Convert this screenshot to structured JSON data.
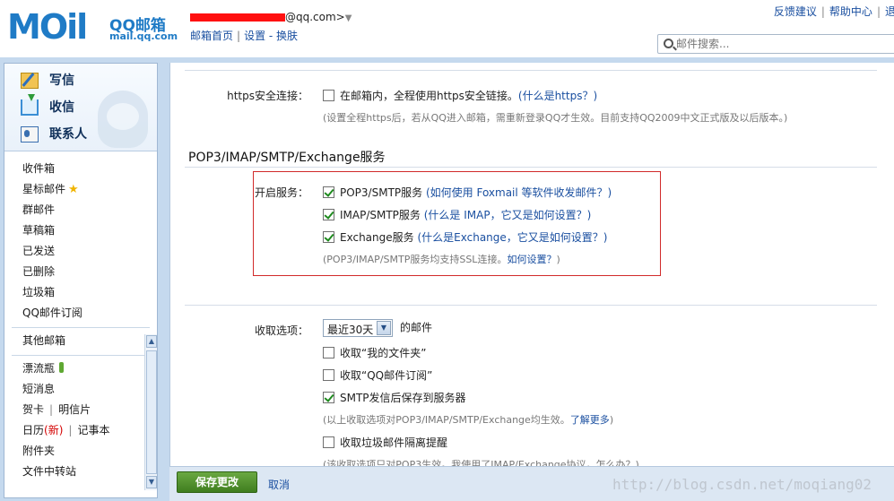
{
  "header": {
    "logo_word": "MOil",
    "logo_name": "QQ邮箱",
    "logo_domain": "mail.qq.com",
    "account_suffix": "@qq.com>",
    "nav": [
      "邮箱首页",
      "设置",
      "换肤"
    ],
    "top_links": [
      "反馈建议",
      "帮助中心",
      "退"
    ],
    "search_placeholder": "邮件搜索..."
  },
  "sidebar": {
    "actions": [
      "写信",
      "收信",
      "联系人"
    ],
    "folders": [
      "收件箱",
      "星标邮件",
      "群邮件",
      "草稿箱",
      "已发送",
      "已删除",
      "垃圾箱",
      "QQ邮件订阅"
    ],
    "other": [
      "其他邮箱"
    ],
    "apps": {
      "drift": "漂流瓶",
      "sms": "短消息",
      "card": "贺卡",
      "postcard": "明信片",
      "calendar": "日历",
      "calendar_new": "(新)",
      "notebook": "记事本",
      "attachments": "附件夹",
      "transfer": "文件中转站"
    }
  },
  "main": {
    "https": {
      "label": "https安全连接：",
      "option": "在邮箱内，全程使用https安全链接。",
      "link": "(什么是https？)",
      "note": "(设置全程https后，若从QQ进入邮箱，需重新登录QQ才生效。目前支持QQ2009中文正式版及以后版本。)",
      "checked": false
    },
    "section_title": "POP3/IMAP/SMTP/Exchange服务",
    "services": {
      "label": "开启服务：",
      "items": [
        {
          "name": "POP3/SMTP服务",
          "link": "(如何使用 Foxmail 等软件收发邮件？)",
          "checked": true
        },
        {
          "name": "IMAP/SMTP服务",
          "link": "(什么是 IMAP，它又是如何设置？)",
          "checked": true
        },
        {
          "name": "Exchange服务",
          "link": "(什么是Exchange，它又是如何设置？)",
          "checked": true
        }
      ],
      "note": "(POP3/IMAP/SMTP服务均支持SSL连接。",
      "note_link": "如何设置？",
      "note_end": ")"
    },
    "receive": {
      "label": "收取选项：",
      "select_value": "最近30天",
      "select_suffix": "的邮件",
      "options": [
        {
          "text": "收取“我的文件夹”",
          "checked": false
        },
        {
          "text": "收取“QQ邮件订阅”",
          "checked": false
        },
        {
          "text": "SMTP发信后保存到服务器",
          "checked": true
        }
      ],
      "note": "(以上收取选项对POP3/IMAP/SMTP/Exchange均生效。",
      "note_link": "了解更多",
      "note_end": ")",
      "spam": {
        "text": "收取垃圾邮件隔离提醒",
        "checked": false
      },
      "spam_note": "(该收取选项只对POP3生效。我使用了IMAP/Exchange协议，怎么办？)"
    }
  },
  "footer": {
    "save": "保存更改",
    "cancel": "取消"
  },
  "watermark": "http://blog.csdn.net/moqiang02"
}
